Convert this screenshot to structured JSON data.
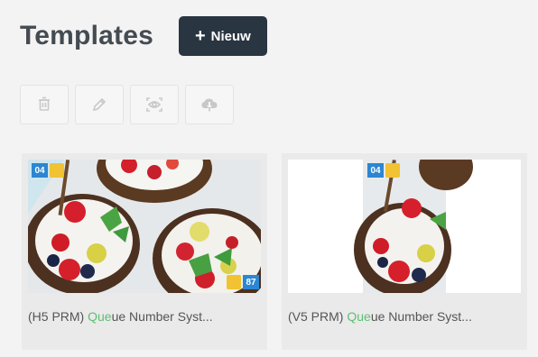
{
  "header": {
    "title": "Templates",
    "new_button_label": "Nieuw",
    "new_button_icon": "+"
  },
  "toolbar": {
    "buttons": [
      {
        "name": "delete",
        "icon": "trash-icon"
      },
      {
        "name": "edit",
        "icon": "pencil-icon"
      },
      {
        "name": "preview",
        "icon": "eye-scan-icon"
      },
      {
        "name": "download",
        "icon": "cloud-download-icon"
      }
    ],
    "icon_color": "#c8c8c8"
  },
  "cards": [
    {
      "label_prefix": "(H5 PRM) ",
      "label_highlight": "Que",
      "label_suffix": "ue Number Syst...",
      "badge_top": "04",
      "badge_bottom": "87",
      "orientation": "horizontal"
    },
    {
      "label_prefix": "(V5 PRM) ",
      "label_highlight": "Que",
      "label_suffix": "ue Number Syst...",
      "badge_top": "04",
      "orientation": "vertical"
    }
  ],
  "colors": {
    "highlight": "#5cbf73",
    "badge": "#2c86d1",
    "button_dark": "#2a3542"
  }
}
